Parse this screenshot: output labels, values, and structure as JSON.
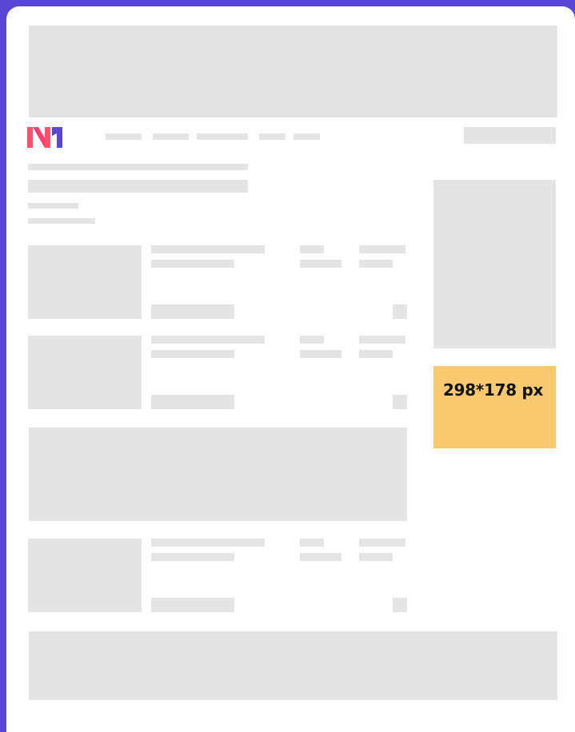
{
  "brand": {
    "logo_text": "N1",
    "colors": {
      "n_left": "#ff4f6d",
      "n_mid": "#ff3c6e",
      "one": "#5b45d4"
    }
  },
  "colors": {
    "frame": "#5b45d4",
    "placeholder": "#e4e4e4",
    "highlight": "#f8c96e",
    "page": "#ffffff"
  },
  "ad_slot": {
    "size_label": "298*178 px"
  }
}
